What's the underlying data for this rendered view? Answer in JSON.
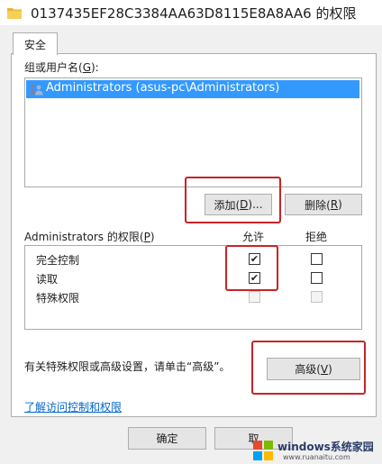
{
  "window": {
    "title": "0137435EF28C3384AA63D8115E8A8AA6 的权限"
  },
  "tabs": [
    {
      "label": "安全"
    }
  ],
  "group_label": "组或用户名(",
  "group_label_key": "G",
  "group_label_end": "):",
  "users": [
    {
      "name": "Administrators (asus-pc\\Administrators)"
    }
  ],
  "buttons": {
    "add_pre": "添加(",
    "add_key": "D",
    "add_post": ")...",
    "remove_pre": "删除(",
    "remove_key": "R",
    "remove_post": ")",
    "advanced_pre": "高级(",
    "advanced_key": "V",
    "advanced_post": ")",
    "ok": "确定",
    "cancel_partial": "取"
  },
  "permissions": {
    "header_pre": "Administrators 的权限(",
    "header_key": "P",
    "header_post": ")",
    "allow_col": "允许",
    "deny_col": "拒绝",
    "rows": [
      {
        "name": "完全控制",
        "allow": true,
        "deny": false,
        "enabled": true
      },
      {
        "name": "读取",
        "allow": true,
        "deny": false,
        "enabled": true
      },
      {
        "name": "特殊权限",
        "allow": false,
        "deny": false,
        "enabled": false
      }
    ]
  },
  "advanced_hint": "有关特殊权限或高级设置，请单击“高级”。",
  "learn_link": "了解访问控制和权限",
  "watermark": {
    "brand": "windows系统家园",
    "url": "www.ruanaitu.com"
  },
  "colors": {
    "selection": "#3399ff",
    "highlight_box": "#c8242a",
    "link": "#0066cc"
  }
}
